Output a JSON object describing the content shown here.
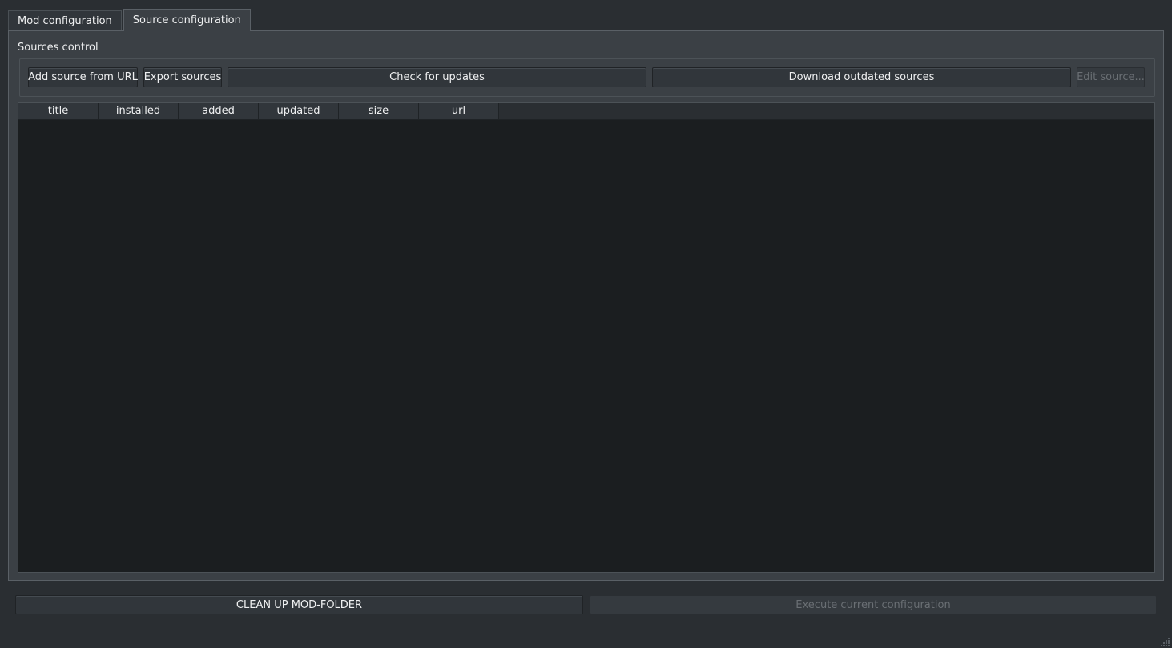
{
  "tabs": [
    {
      "label": "Mod configuration",
      "active": false
    },
    {
      "label": "Source configuration",
      "active": true
    }
  ],
  "sources_control": {
    "title": "Sources control",
    "buttons": {
      "add_source": "Add source from URL",
      "export_sources": "Export sources",
      "check_updates": "Check for updates",
      "download_outdated": "Download outdated sources",
      "edit_source": "Edit source..."
    }
  },
  "table": {
    "columns": [
      "title",
      "installed",
      "added",
      "updated",
      "size",
      "url"
    ],
    "rows": []
  },
  "bottom": {
    "clean_up": "CLEAN UP MOD-FOLDER",
    "execute": "Execute current configuration"
  },
  "colors": {
    "window_bg": "#2a2e32",
    "panel_bg": "#3b4045",
    "table_bg": "#1b1e20",
    "text": "#eff0f1",
    "disabled_text": "#6a6f74"
  }
}
